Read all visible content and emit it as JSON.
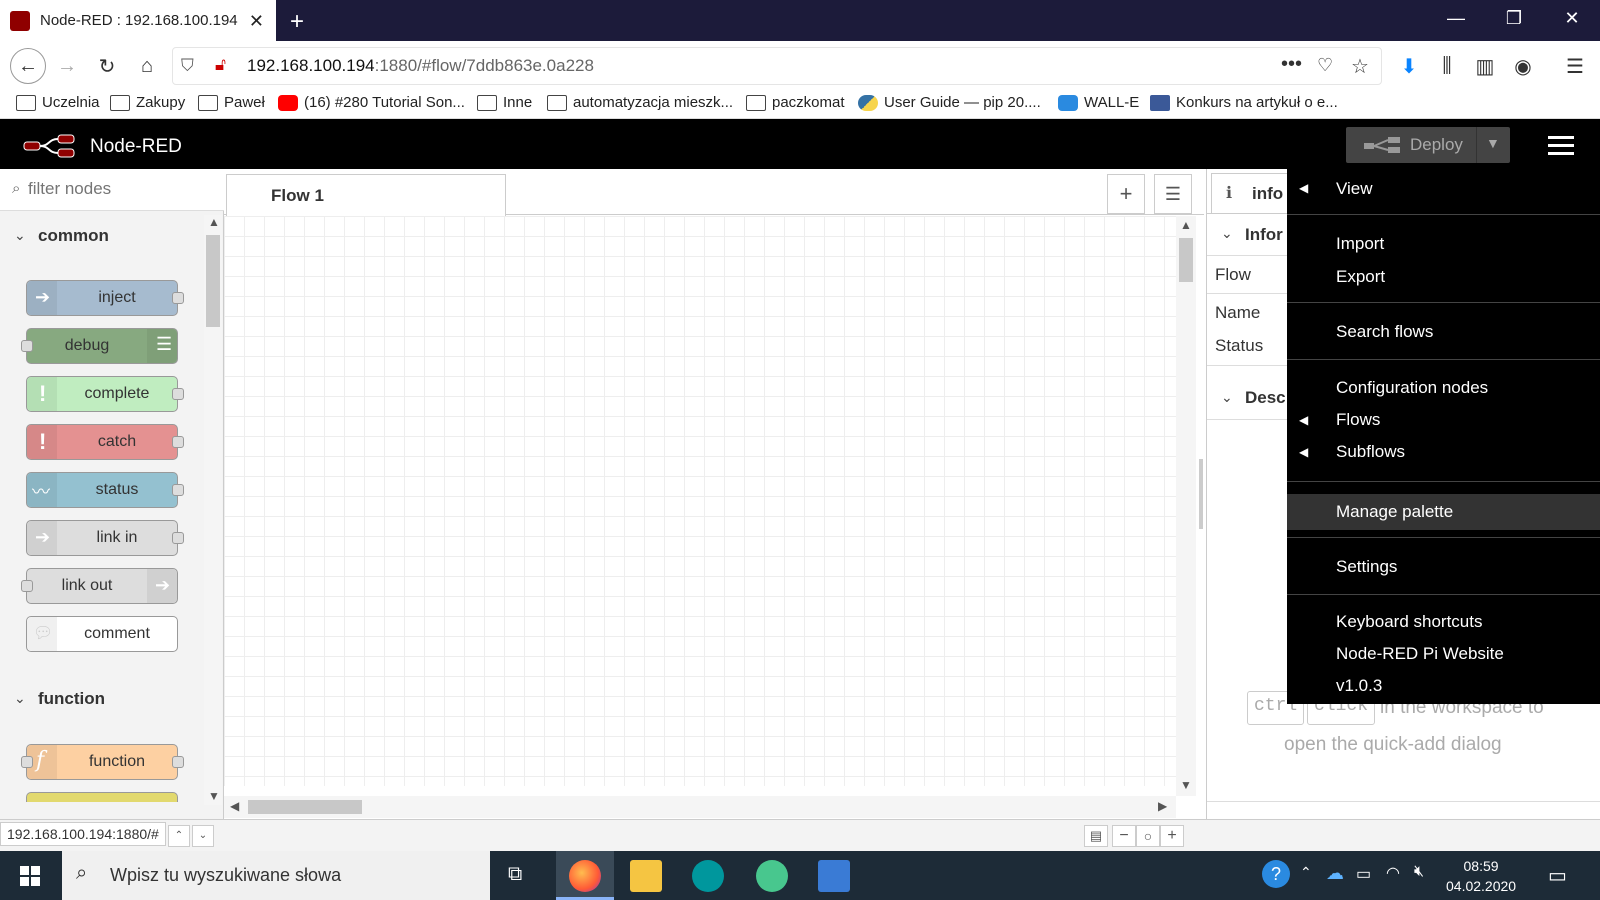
{
  "browser": {
    "tab_title": "Node-RED : 192.168.100.194",
    "url_host": "192.168.100.194",
    "url_rest": ":1880/#flow/7ddb863e.0a228",
    "bookmarks": [
      "Uczelnia",
      "Zakupy",
      "Paweł",
      "(16) #280 Tutorial Son...",
      "Inne",
      "automatyzacja mieszk...",
      "paczkomat",
      "User Guide — pip 20....",
      "WALL-E",
      "Konkurs na artykuł o e..."
    ],
    "status_url": "192.168.100.194:1880/#"
  },
  "header": {
    "app_name": "Node-RED",
    "deploy_label": "Deploy"
  },
  "palette": {
    "filter_placeholder": "filter nodes",
    "categories": [
      "common",
      "function"
    ],
    "common_nodes": [
      "inject",
      "debug",
      "complete",
      "catch",
      "status",
      "link in",
      "link out",
      "comment"
    ],
    "function_nodes": [
      "function"
    ]
  },
  "workspace": {
    "tab_label": "Flow 1"
  },
  "sidebar": {
    "tab_label": "info",
    "section_info": "Infor",
    "rows": [
      "Flow",
      "Name",
      "Status"
    ],
    "section_desc": "Desc",
    "hint_key1": "ctrl",
    "hint_key2": "click",
    "hint_text1": "in the workspace to",
    "hint_text2": "open the quick-add dialog"
  },
  "menu": {
    "items": [
      "View",
      "Import",
      "Export",
      "Search flows",
      "Configuration nodes",
      "Flows",
      "Subflows",
      "Manage palette",
      "Settings",
      "Keyboard shortcuts",
      "Node-RED Pi Website",
      "v1.0.3"
    ]
  },
  "taskbar": {
    "search_placeholder": "Wpisz tu wyszukiwane słowa",
    "time": "08:59",
    "date": "04.02.2020"
  },
  "colors": {
    "inject": "#a6bbcf",
    "debug": "#87a980",
    "complete": "#c0edc0",
    "catch": "#e49191",
    "status": "#94c1d0",
    "link": "#dddddd",
    "comment": "#ffffff",
    "function": "#fdd0a2"
  }
}
